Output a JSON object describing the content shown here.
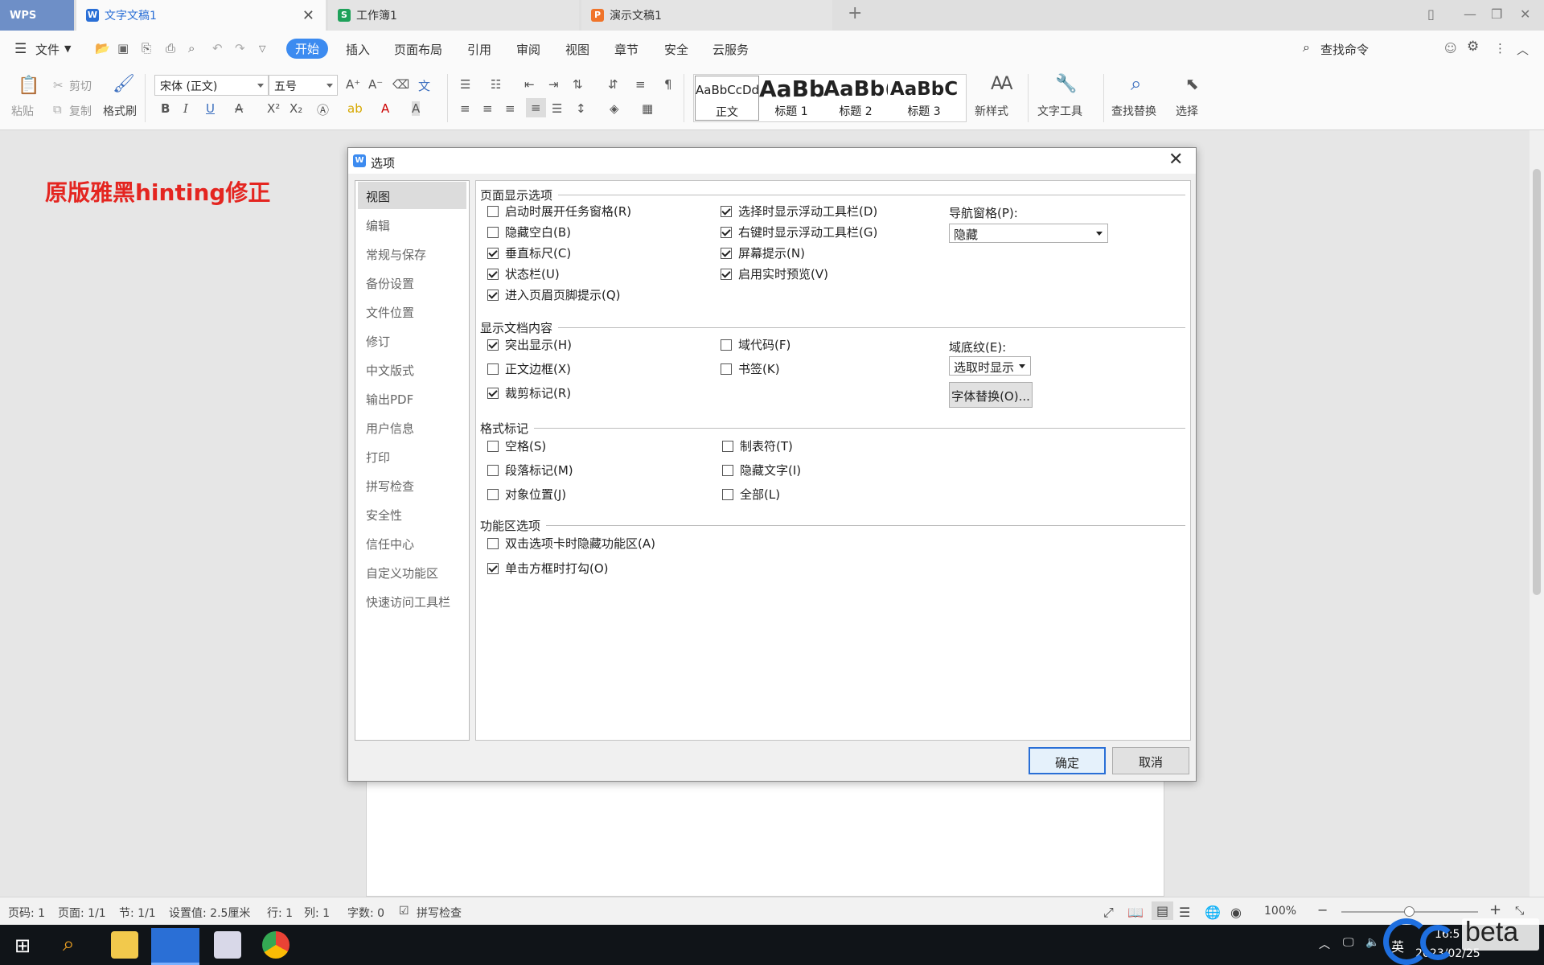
{
  "titlebar": {
    "app": "WPS",
    "tabs": [
      {
        "label": "文字文稿1",
        "icon": "writer-icon",
        "color": "#2a6fd6"
      },
      {
        "label": "工作簿1",
        "icon": "spreadsheet-icon",
        "color": "#1fa15a"
      },
      {
        "label": "演示文稿1",
        "icon": "presentation-icon",
        "color": "#f0742a"
      }
    ]
  },
  "menu": {
    "file": "文件",
    "items": [
      "开始",
      "插入",
      "页面布局",
      "引用",
      "审阅",
      "视图",
      "章节",
      "安全",
      "云服务"
    ],
    "search": "查找命令"
  },
  "ribbon": {
    "paste": "粘贴",
    "cut": "剪切",
    "copy": "复制",
    "format_painter": "格式刷",
    "font": "宋体 (正文)",
    "size": "五号",
    "styles": [
      {
        "preview": "AaBbCcDd",
        "name": "正文"
      },
      {
        "preview": "AaBb",
        "name": "标题 1"
      },
      {
        "preview": "AaBb(",
        "name": "标题 2"
      },
      {
        "preview": "AaBbC",
        "name": "标题 3"
      }
    ],
    "new_style": "新样式",
    "text_tools": "文字工具",
    "find_replace": "查找替换",
    "select": "选择"
  },
  "document": {
    "heading": "原版雅黑hinting修正"
  },
  "dialog": {
    "title": "选项",
    "nav": [
      "视图",
      "编辑",
      "常规与保存",
      "备份设置",
      "文件位置",
      "修订",
      "中文版式",
      "输出PDF",
      "用户信息",
      "打印",
      "拼写检查",
      "安全性",
      "信任中心",
      "自定义功能区",
      "快速访问工具栏"
    ],
    "sections": {
      "page_display": "页面显示选项",
      "doc_content": "显示文档内容",
      "format_marks": "格式标记",
      "ribbon_opts": "功能区选项"
    },
    "page_display_col1": [
      {
        "label": "启动时展开任务窗格(R)",
        "checked": false
      },
      {
        "label": "隐藏空白(B)",
        "checked": false
      },
      {
        "label": "垂直标尺(C)",
        "checked": true
      },
      {
        "label": "状态栏(U)",
        "checked": true
      },
      {
        "label": "进入页眉页脚提示(Q)",
        "checked": true
      }
    ],
    "page_display_col2": [
      {
        "label": "选择时显示浮动工具栏(D)",
        "checked": true
      },
      {
        "label": "右键时显示浮动工具栏(G)",
        "checked": true
      },
      {
        "label": "屏幕提示(N)",
        "checked": true
      },
      {
        "label": "启用实时预览(V)",
        "checked": true
      }
    ],
    "nav_pane_label": "导航窗格(P):",
    "nav_pane_value": "隐藏",
    "doc_content_col1": [
      {
        "label": "突出显示(H)",
        "checked": true
      },
      {
        "label": "正文边框(X)",
        "checked": false
      },
      {
        "label": "裁剪标记(R)",
        "checked": true
      }
    ],
    "doc_content_col2": [
      {
        "label": "域代码(F)",
        "checked": false
      },
      {
        "label": "书签(K)",
        "checked": false
      }
    ],
    "field_shading_label": "域底纹(E):",
    "field_shading_value": "选取时显示",
    "font_sub_button": "字体替换(O)...",
    "format_marks_col1": [
      {
        "label": "空格(S)",
        "checked": false
      },
      {
        "label": "段落标记(M)",
        "checked": false
      },
      {
        "label": "对象位置(J)",
        "checked": false
      }
    ],
    "format_marks_col2": [
      {
        "label": "制表符(T)",
        "checked": false
      },
      {
        "label": "隐藏文字(I)",
        "checked": false
      },
      {
        "label": "全部(L)",
        "checked": false
      }
    ],
    "ribbon_options": [
      {
        "label": "双击选项卡时隐藏功能区(A)",
        "checked": false
      },
      {
        "label": "单击方框时打勾(O)",
        "checked": true
      }
    ],
    "ok": "确定",
    "cancel": "取消"
  },
  "status": {
    "page_num": "页码: 1",
    "pages": "页面: 1/1",
    "section": "节: 1/1",
    "setting": "设置值: 2.5厘米",
    "row": "行: 1",
    "col": "列: 1",
    "words": "字数: 0",
    "spell": "拼写检查",
    "zoom": "100%"
  },
  "taskbar": {
    "ime": "英",
    "time": "16:5",
    "date": "2023/02/25",
    "watermark": "beta"
  }
}
